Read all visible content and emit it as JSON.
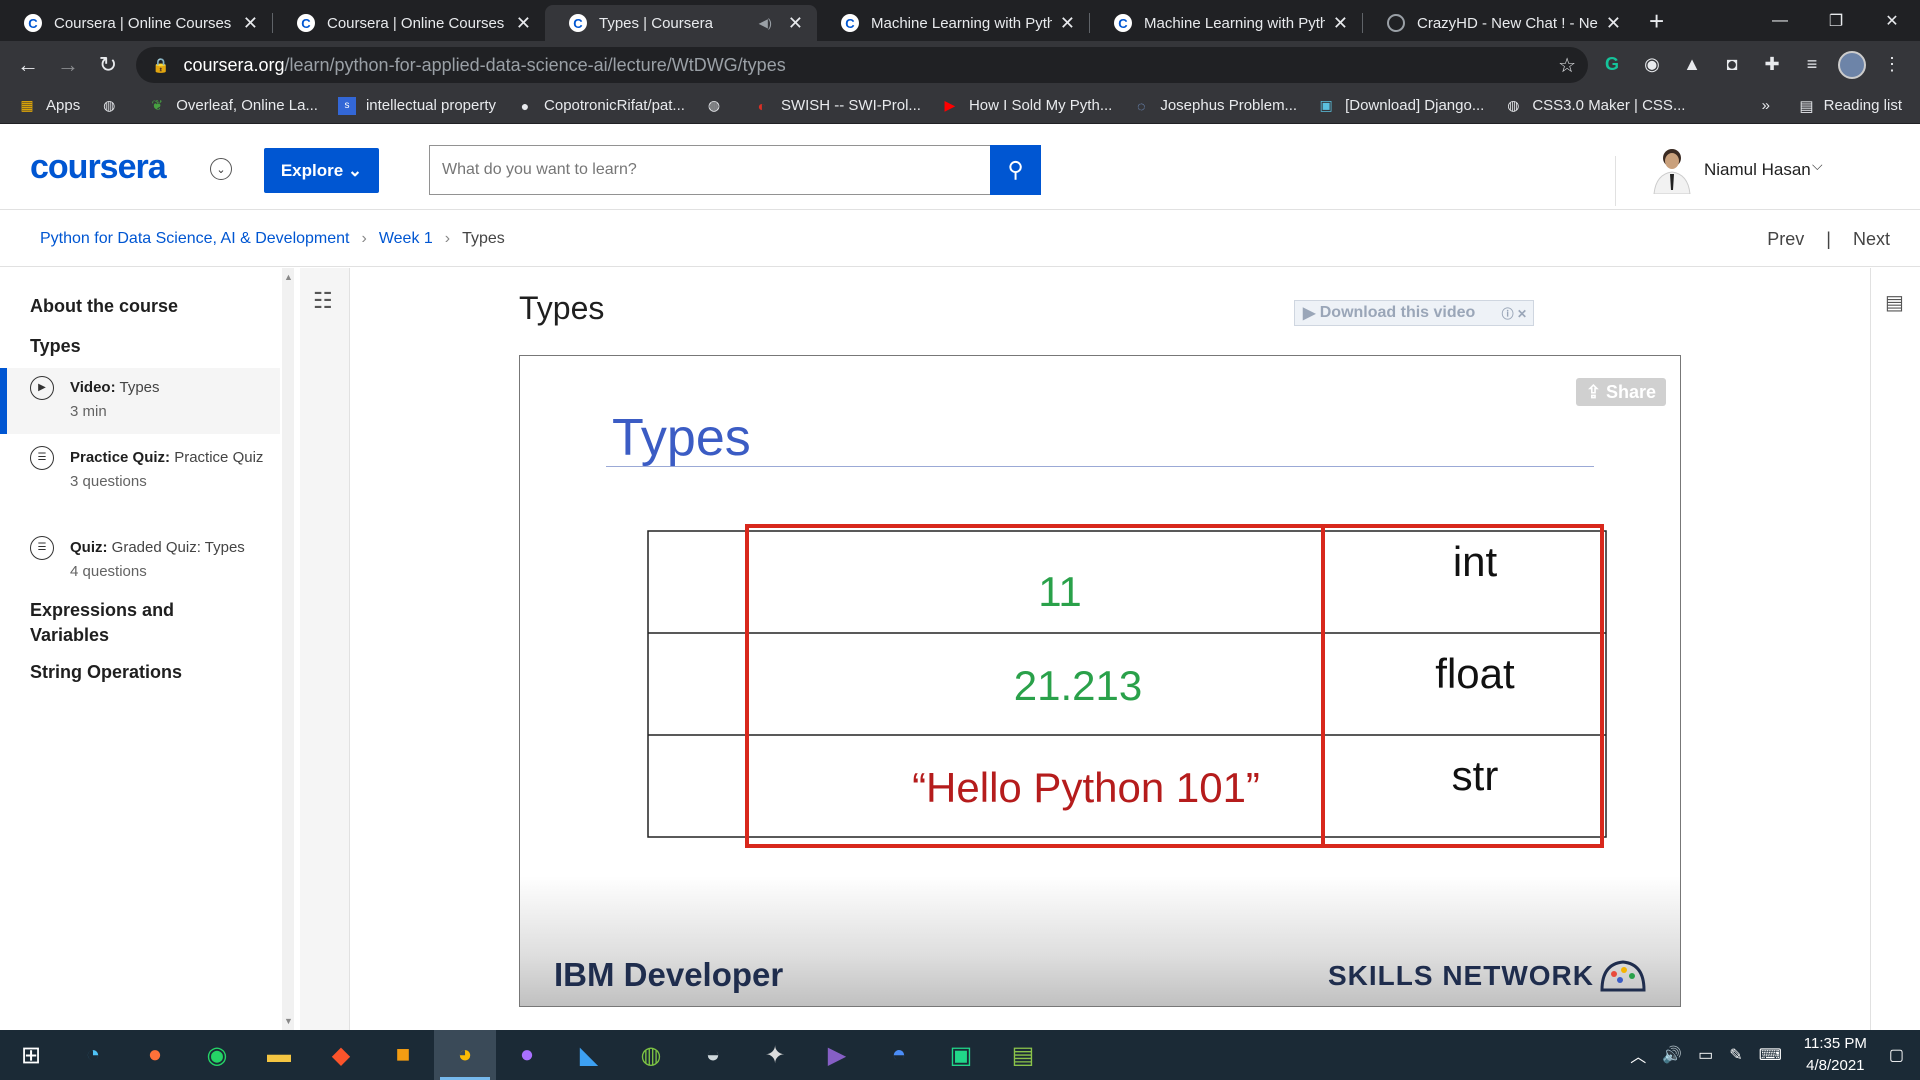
{
  "browser": {
    "tabs": [
      {
        "title": "Coursera | Online Courses & C",
        "icon": "coursera-favicon"
      },
      {
        "title": "Coursera | Online Courses & C",
        "icon": "coursera-favicon"
      },
      {
        "title": "Types | Coursera",
        "icon": "coursera-favicon",
        "active": true
      },
      {
        "title": "Machine Learning with Pytho",
        "icon": "coursera-favicon"
      },
      {
        "title": "Machine Learning with Pytho",
        "icon": "coursera-favicon"
      },
      {
        "title": "CrazyHD - New Chat ! - New",
        "icon": "globe-icon"
      }
    ],
    "url_host": "coursera.org",
    "url_path": "/learn/python-for-applied-data-science-ai/lecture/WtDWG/types",
    "bookmarks": [
      {
        "label": "Apps",
        "icon": "apps-grid-icon"
      },
      {
        "label": "",
        "icon": "globe-icon"
      },
      {
        "label": "Overleaf, Online La...",
        "icon": "overleaf-icon"
      },
      {
        "label": "intellectual property",
        "icon": "doc-icon"
      },
      {
        "label": "CopotronicRifat/pat...",
        "icon": "github-icon"
      },
      {
        "label": "",
        "icon": "globe-icon"
      },
      {
        "label": "SWISH -- SWI-Prol...",
        "icon": "swish-icon"
      },
      {
        "label": "How I Sold My Pyth...",
        "icon": "youtube-icon"
      },
      {
        "label": "Josephus Problem...",
        "icon": "loading-icon"
      },
      {
        "label": "[Download] Django...",
        "icon": "django-icon"
      },
      {
        "label": "CSS3.0 Maker | CSS...",
        "icon": "globe-icon"
      }
    ],
    "bookmarks_more": "»",
    "reading_list": "Reading list"
  },
  "coursera": {
    "logo": "coursera",
    "explore_label": "Explore",
    "search_placeholder": "What do you want to learn?",
    "user_name": "Niamul Hasan",
    "brand_color": "#0056d2"
  },
  "breadcrumb": {
    "course": "Python for Data Science, AI & Development",
    "week": "Week 1",
    "current": "Types",
    "prev": "Prev",
    "next": "Next"
  },
  "sidebar": {
    "about": "About the course",
    "section": "Types",
    "items": [
      {
        "kind": "Video:",
        "title": "Types",
        "meta": "3 min",
        "icon": "play-circle-icon",
        "active": true
      },
      {
        "kind": "Practice Quiz:",
        "title": "Practice Quiz",
        "meta": "3 questions",
        "icon": "quiz-icon"
      },
      {
        "kind": "Quiz:",
        "title": "Graded Quiz: Types",
        "meta": "4 questions",
        "icon": "quiz-icon"
      }
    ],
    "other_sections": [
      "Expressions and Variables",
      "String Operations"
    ]
  },
  "lecture": {
    "title": "Types",
    "download_label": "Download this video",
    "share_label": "Share",
    "slide": {
      "title": "Types",
      "rows": [
        {
          "value": "11",
          "type": "int",
          "value_color": "#2aa14a"
        },
        {
          "value": "21.213",
          "type": "float",
          "value_color": "#2aa14a"
        },
        {
          "value": "“Hello Python 101”",
          "type": "str",
          "value_color": "#b51c1c"
        }
      ],
      "footer_left": "IBM Developer",
      "footer_right": "SKILLS NETWORK"
    }
  },
  "taskbar": {
    "apps": [
      "windows-start-icon",
      "search-ring-icon",
      "firefox-icon",
      "whatsapp-icon",
      "file-explorer-icon",
      "brave-icon",
      "photo-app-icon",
      "chrome-icon",
      "github-desktop-icon",
      "vscode-icon",
      "globe-app-icon",
      "wireshark-icon",
      "eclipse-icon",
      "visual-studio-icon",
      "messenger-icon",
      "pycharm-icon",
      "notepad-icon"
    ],
    "time": "11:35 PM",
    "date": "4/8/2021"
  }
}
